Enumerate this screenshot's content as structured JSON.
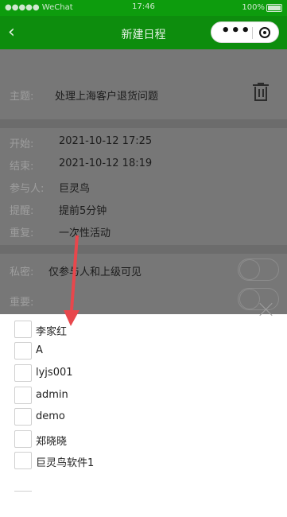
{
  "status_bar": {
    "signal": "●●●●● WeChat",
    "time": "17:46",
    "battery": "100%"
  },
  "nav": {
    "back_icon": "chevron-left-icon",
    "title": "新建日程",
    "capsule_dots": "•••"
  },
  "form": {
    "subject": {
      "label": "主题:",
      "value": "处理上海客户退货问题"
    },
    "start": {
      "label": "开始:",
      "value": "2021-10-12 17:25"
    },
    "end": {
      "label": "结束:",
      "value": "2021-10-12 18:19"
    },
    "participants": {
      "label": "参与人:",
      "value": "巨灵鸟"
    },
    "reminder": {
      "label": "提醒:",
      "value": "提前5分钟"
    },
    "repeat": {
      "label": "重复:",
      "value": "一次性活动"
    },
    "privacy": {
      "label": "私密:",
      "value": "仅参与人和上级可见",
      "enabled": false
    },
    "important": {
      "label": "重要:",
      "value": "",
      "enabled": false
    }
  },
  "picker": {
    "options": [
      {
        "label": "李家红",
        "checked": false
      },
      {
        "label": "A",
        "checked": false
      },
      {
        "label": "lyjs001",
        "checked": false
      },
      {
        "label": "admin",
        "checked": false
      },
      {
        "label": "demo",
        "checked": false
      },
      {
        "label": "郑晓晓",
        "checked": false
      },
      {
        "label": "巨灵鸟软件1",
        "checked": false
      }
    ]
  },
  "colors": {
    "nav": "#0d8d0d",
    "overlay": "#777777",
    "arrow": "#e8474c"
  }
}
